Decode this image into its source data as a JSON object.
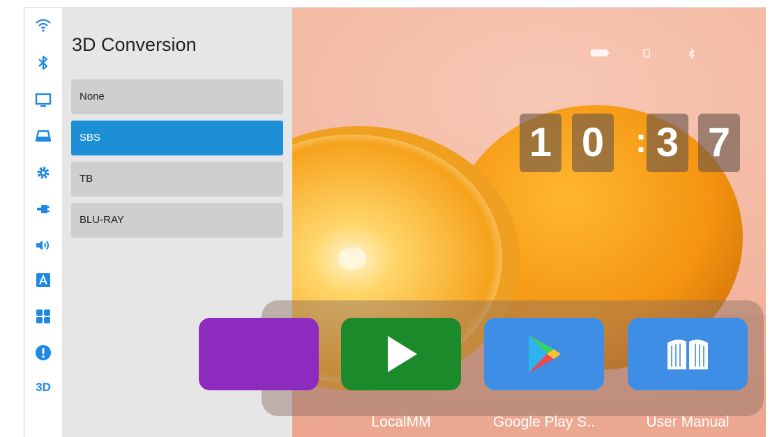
{
  "sidebar": {
    "icons": [
      "wifi-icon",
      "bluetooth-icon",
      "display-icon",
      "projector-icon",
      "settings-gear-icon",
      "input-source-icon",
      "volume-icon",
      "language-icon",
      "apps-grid-icon",
      "info-icon",
      "3d-icon"
    ],
    "three_d_label": "3D",
    "accent": "#1e88e5"
  },
  "panel": {
    "title": "3D Conversion",
    "options": [
      {
        "label": "None",
        "selected": false
      },
      {
        "label": "SBS",
        "selected": true
      },
      {
        "label": "TB",
        "selected": false
      },
      {
        "label": "BLU-RAY",
        "selected": false
      }
    ],
    "selected_color": "#1c8fd7"
  },
  "status_bar": {
    "icons": [
      "battery-icon",
      "usb-icon",
      "bluetooth-status-icon"
    ]
  },
  "clock": {
    "digits": [
      "1",
      "0",
      "3",
      "7"
    ],
    "separator": ":"
  },
  "dock": {
    "apps": [
      {
        "label": "",
        "icon": "purple-app-icon",
        "color": "#8e2bbf"
      },
      {
        "label": "LocalMM",
        "icon": "play-icon",
        "color": "#1a8a2a"
      },
      {
        "label": "Google Play S..",
        "icon": "google-play-icon",
        "color": "#3f8ee6"
      },
      {
        "label": "User Manual",
        "icon": "book-icon",
        "color": "#3f8ee6"
      }
    ]
  }
}
